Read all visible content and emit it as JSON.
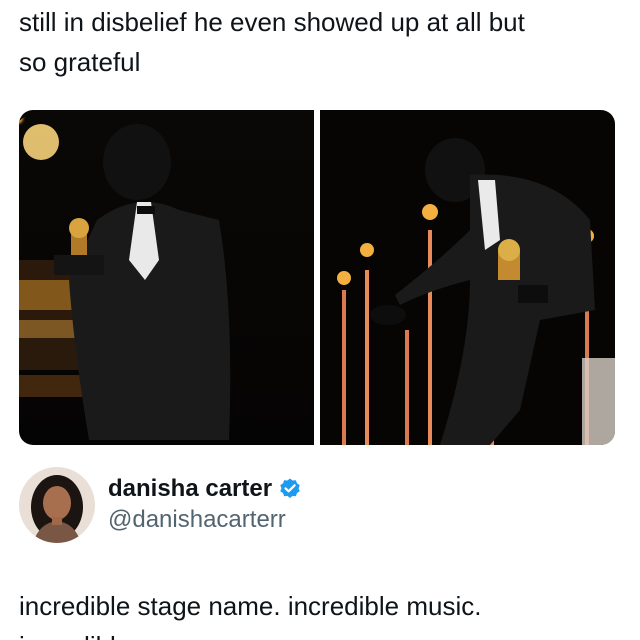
{
  "post": {
    "text_line1": "still in disbelief he even showed up at all but",
    "text_line2": "so grateful"
  },
  "media": {
    "images": [
      {
        "icon": "award-photo-holding-trophy"
      },
      {
        "icon": "award-photo-bowing-with-trophy"
      }
    ]
  },
  "author": {
    "display_name": "danisha carter",
    "handle": "@danishacarterr",
    "verified": true,
    "verified_color": "#1d9bf0"
  },
  "quote": {
    "text_line1": "incredible stage name. incredible music.",
    "text_line2": "incredible aura."
  }
}
